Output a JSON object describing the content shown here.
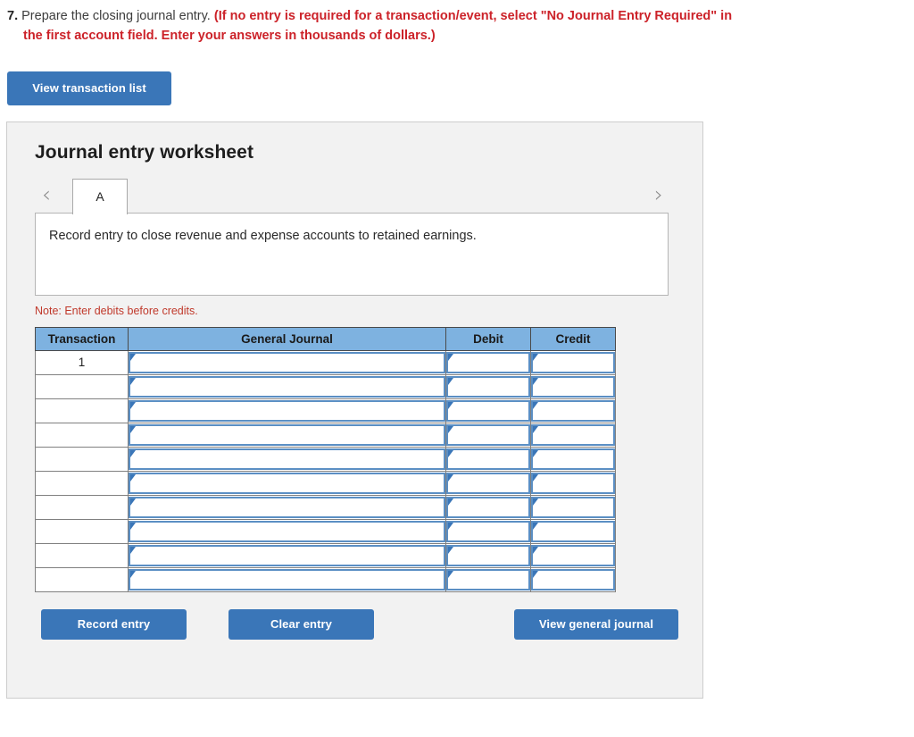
{
  "prompt": {
    "number": "7.",
    "text": "Prepare the closing journal entry.",
    "emphasis_line1": "(If no entry is required for a transaction/event, select \"No Journal Entry Required\" in",
    "emphasis_line2": "the first account field. Enter your answers in thousands of dollars.)"
  },
  "toolbar": {
    "view_transaction_list_label": "View transaction list"
  },
  "worksheet": {
    "title": "Journal entry worksheet",
    "prev_icon": "chevron-left-icon",
    "next_icon": "chevron-right-icon",
    "tabs": [
      {
        "label": "A",
        "active": true
      }
    ],
    "description": "Record entry to close revenue and expense accounts to retained earnings.",
    "note": "Note: Enter debits before credits."
  },
  "table": {
    "columns": [
      "Transaction",
      "General Journal",
      "Debit",
      "Credit"
    ],
    "rows": [
      {
        "transaction": "1",
        "general_journal": "",
        "debit": "",
        "credit": ""
      },
      {
        "transaction": "",
        "general_journal": "",
        "debit": "",
        "credit": ""
      },
      {
        "transaction": "",
        "general_journal": "",
        "debit": "",
        "credit": ""
      },
      {
        "transaction": "",
        "general_journal": "",
        "debit": "",
        "credit": ""
      },
      {
        "transaction": "",
        "general_journal": "",
        "debit": "",
        "credit": ""
      },
      {
        "transaction": "",
        "general_journal": "",
        "debit": "",
        "credit": ""
      },
      {
        "transaction": "",
        "general_journal": "",
        "debit": "",
        "credit": ""
      },
      {
        "transaction": "",
        "general_journal": "",
        "debit": "",
        "credit": ""
      },
      {
        "transaction": "",
        "general_journal": "",
        "debit": "",
        "credit": ""
      },
      {
        "transaction": "",
        "general_journal": "",
        "debit": "",
        "credit": ""
      }
    ]
  },
  "actions": {
    "record_entry_label": "Record entry",
    "clear_entry_label": "Clear entry",
    "view_general_journal_label": "View general journal"
  },
  "colors": {
    "button_blue": "#3a76b8",
    "header_blue": "#7eb2e0",
    "note_red": "#c0392b",
    "emphasis_red": "#cc2229",
    "panel_bg": "#f2f2f2"
  }
}
